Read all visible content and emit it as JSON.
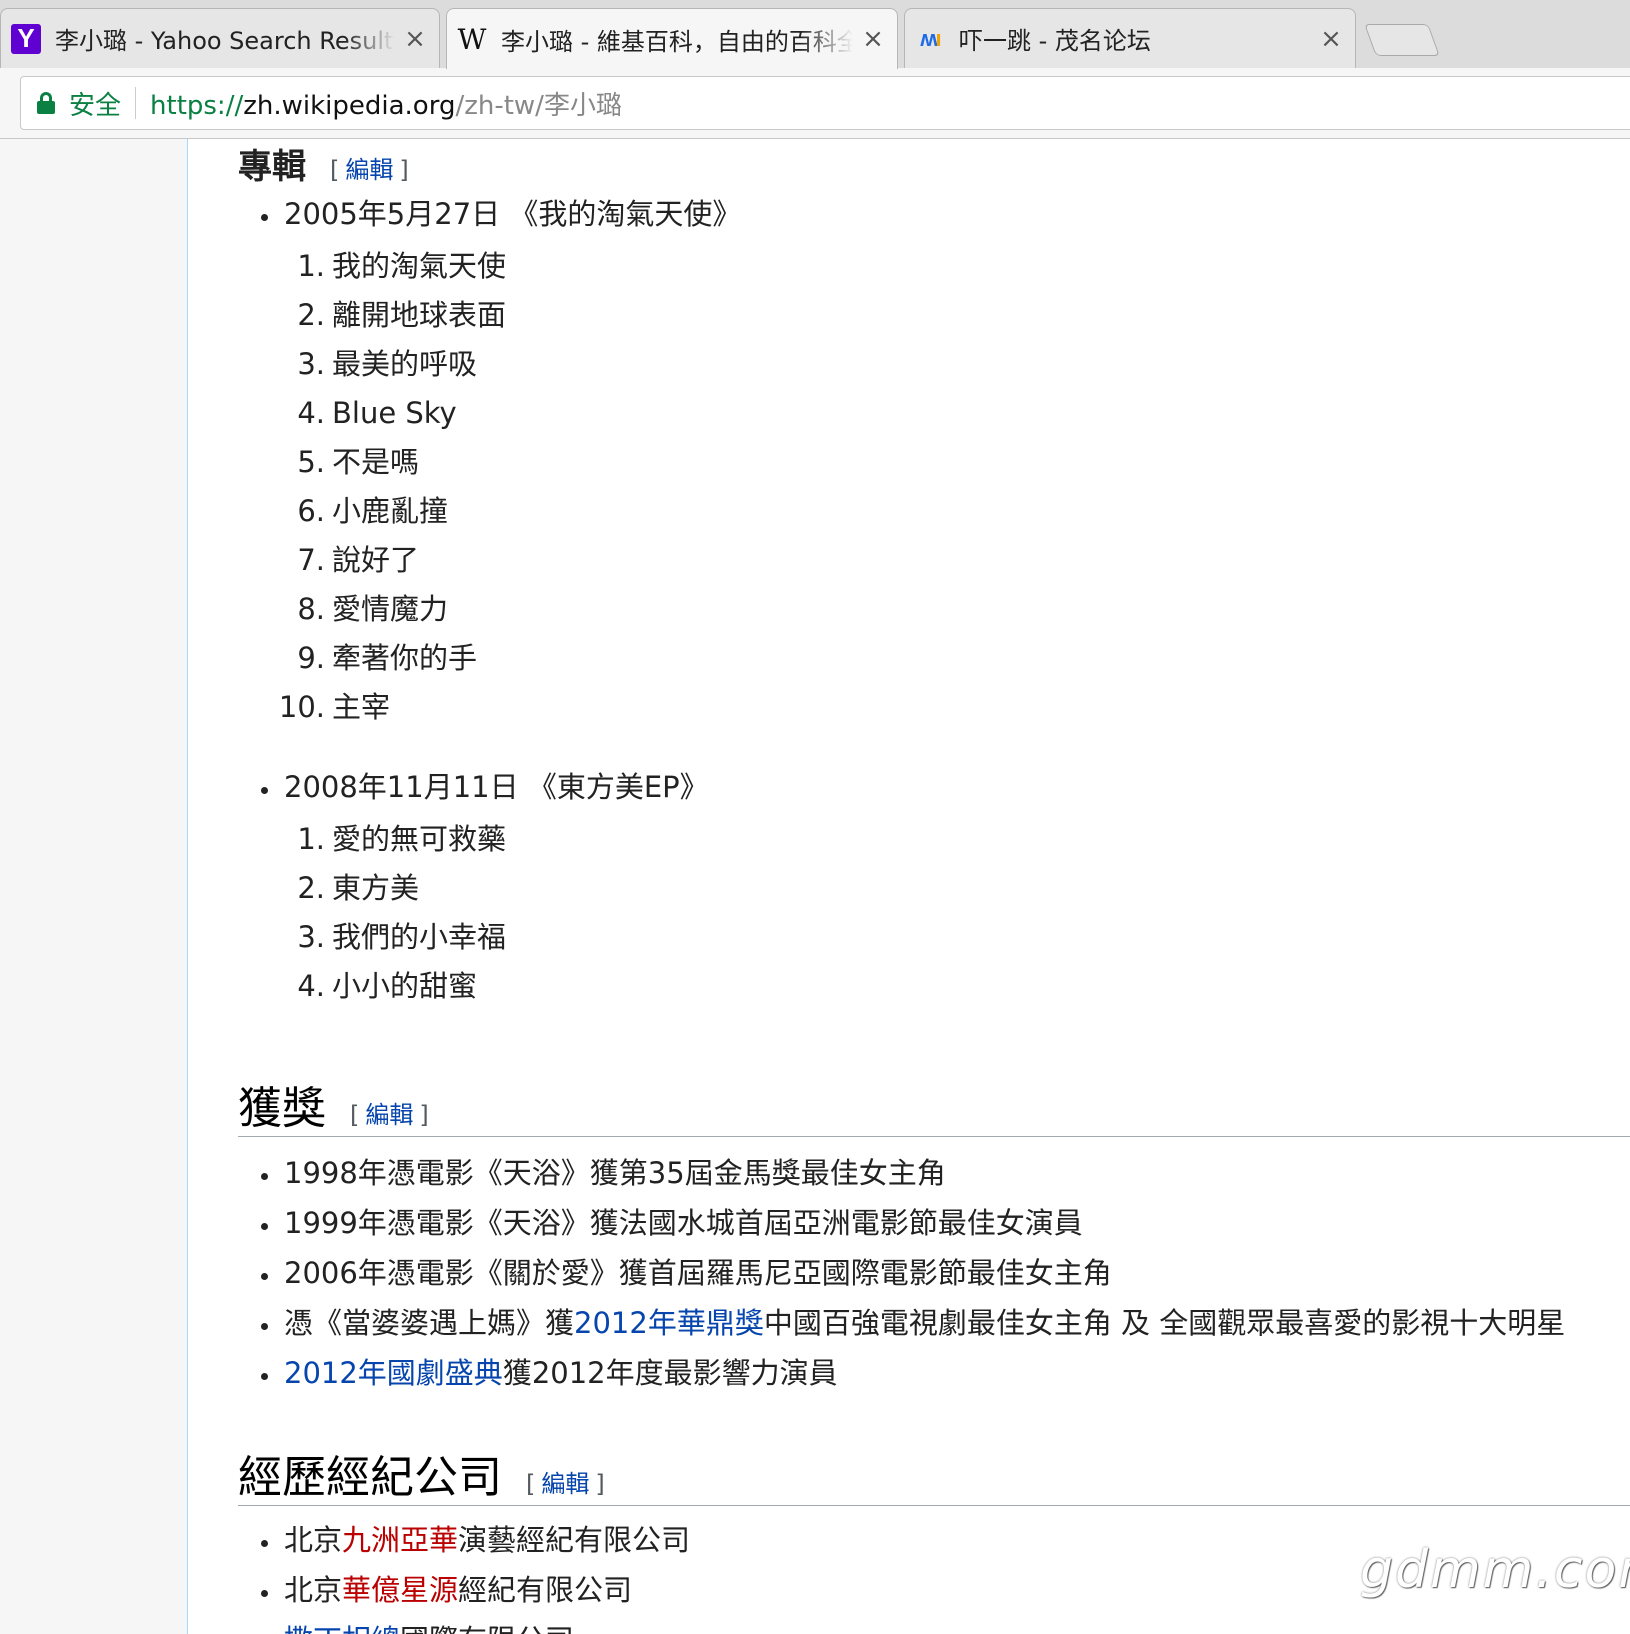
{
  "tabs": [
    {
      "favicon": "yahoo-icon",
      "favicon_text": "Y",
      "title": "李小璐 - Yahoo Search Results",
      "close": "×"
    },
    {
      "favicon": "wikipedia-icon",
      "favicon_text": "W",
      "title": "李小璐 - 維基百科，自由的百科全書",
      "close": "×"
    },
    {
      "favicon": "maoming-icon",
      "favicon_text": "M",
      "title": "吓一跳 - 茂名论坛",
      "close": "×"
    }
  ],
  "address_bar": {
    "secure_label": "安全",
    "url_scheme": "https://",
    "url_host": "zh.wikipedia.org",
    "url_path": "/zh-tw/李小璐"
  },
  "edit_label": "編輯",
  "albums_section": {
    "title": "專輯",
    "albums": [
      {
        "heading": "2005年5月27日 《我的淘氣天使》",
        "tracks": [
          "我的淘氣天使",
          "離開地球表面",
          "最美的呼吸",
          "Blue Sky",
          "不是嗎",
          "小鹿亂撞",
          "說好了",
          "愛情魔力",
          "牽著你的手",
          "主宰"
        ]
      },
      {
        "heading": "2008年11月11日 《東方美EP》",
        "tracks": [
          "愛的無可救藥",
          "東方美",
          "我們的小幸福",
          "小小的甜蜜"
        ]
      }
    ]
  },
  "awards_section": {
    "title": "獲獎",
    "items": [
      {
        "text": "1998年憑電影《天浴》獲第35屆金馬獎最佳女主角"
      },
      {
        "text": "1999年憑電影《天浴》獲法國水城首屆亞洲電影節最佳女演員"
      },
      {
        "text": "2006年憑電影《關於愛》獲首屆羅馬尼亞國際電影節最佳女主角"
      },
      {
        "pre": "憑《當婆婆遇上媽》獲",
        "link": "2012年華鼎獎",
        "post": "中國百強電視劇最佳女主角 及 全國觀眾最喜愛的影視十大明星"
      },
      {
        "pre": "",
        "link": "2012年國劇盛典",
        "post": "獲2012年度最影響力演員"
      }
    ]
  },
  "agency_section": {
    "title": "經歷經紀公司",
    "items": [
      {
        "pre": "北京",
        "link": "九洲亞華",
        "post": "演藝經紀有限公司"
      },
      {
        "pre": "北京",
        "link": "華億星源",
        "post": "經紀有限公司"
      },
      {
        "pre": "",
        "link": "撒丁相總",
        "post": "國際有限公司"
      }
    ]
  },
  "watermark": "gdmm.com",
  "colors": {
    "link": "#0645ad",
    "redlink": "#ba0000",
    "secure": "#0b8043",
    "yahoo": "#5f01d1"
  }
}
